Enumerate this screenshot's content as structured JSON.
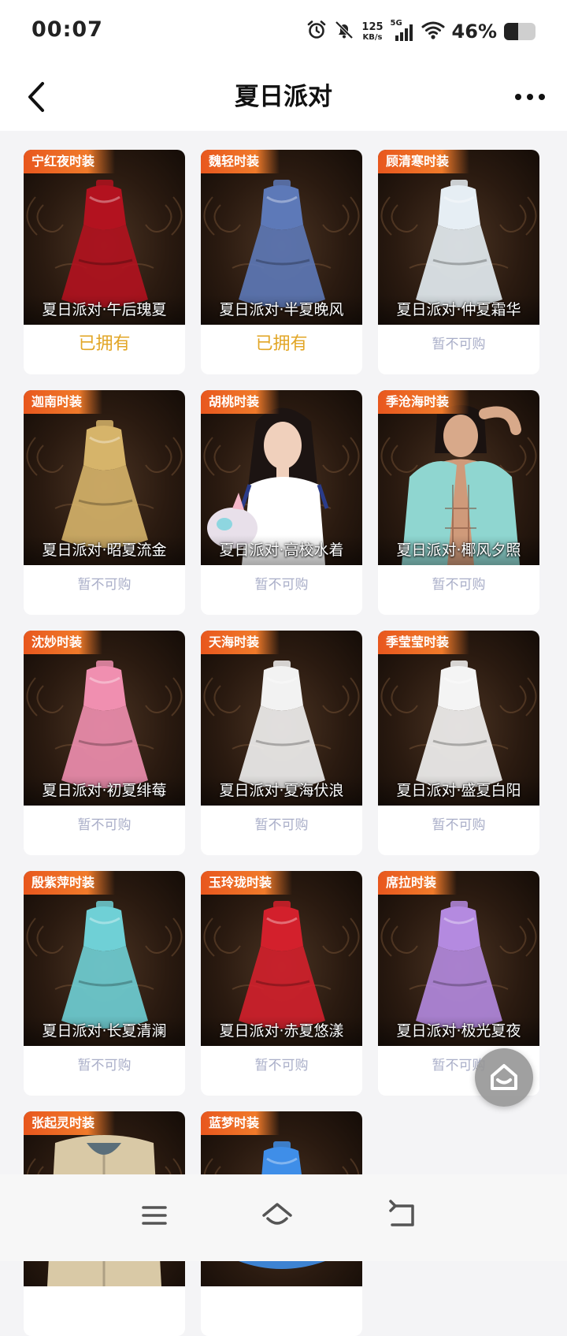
{
  "status_bar": {
    "time": "00:07",
    "net_speed_value": "125",
    "net_speed_unit": "KB/s",
    "network_type": "5G",
    "battery_percent": "46%",
    "battery_level": 0.46,
    "icons": [
      "alarm-icon",
      "mute-bell-icon",
      "signal-icon",
      "wifi-icon",
      "battery-icon"
    ]
  },
  "header": {
    "title": "夏日派对",
    "back_icon": "chevron-left-icon",
    "more_icon": "more-dots-icon"
  },
  "items": [
    {
      "tag": "宁红夜时装",
      "name": "夏日派对·午后瑰夏",
      "status": "已拥有",
      "owned": true,
      "art": "dress",
      "color": "#b3121f"
    },
    {
      "tag": "魏轻时装",
      "name": "夏日派对·半夏晚风",
      "status": "已拥有",
      "owned": true,
      "art": "dress",
      "color": "#5d79b8"
    },
    {
      "tag": "顾清寒时装",
      "name": "夏日派对·仲夏霜华",
      "status": "暂不可购",
      "owned": false,
      "art": "dress",
      "color": "#e6eef4"
    },
    {
      "tag": "迦南时装",
      "name": "夏日派对·昭夏流金",
      "status": "暂不可购",
      "owned": false,
      "art": "dress",
      "color": "#d6b46a"
    },
    {
      "tag": "胡桃时装",
      "name": "夏日派对·高校水着",
      "status": "暂不可购",
      "owned": false,
      "art": "girl",
      "color": "#ffffff"
    },
    {
      "tag": "季沧海时装",
      "name": "夏日派对·椰风夕照",
      "status": "暂不可购",
      "owned": false,
      "art": "man",
      "color": "#8fd6d0"
    },
    {
      "tag": "沈妙时装",
      "name": "夏日派对·初夏绯莓",
      "status": "暂不可购",
      "owned": false,
      "art": "dress",
      "color": "#f08fb0"
    },
    {
      "tag": "天海时装",
      "name": "夏日派对·夏海伏浪",
      "status": "暂不可购",
      "owned": false,
      "art": "dress",
      "color": "#f2f2f2"
    },
    {
      "tag": "季莹莹时装",
      "name": "夏日派对·盛夏白阳",
      "status": "暂不可购",
      "owned": false,
      "art": "dress",
      "color": "#f4f4f4"
    },
    {
      "tag": "殷紫萍时装",
      "name": "夏日派对·长夏清澜",
      "status": "暂不可购",
      "owned": false,
      "art": "dress",
      "color": "#6fd0d6"
    },
    {
      "tag": "玉玲珑时装",
      "name": "夏日派对·赤夏悠漾",
      "status": "暂不可购",
      "owned": false,
      "art": "dress",
      "color": "#d3202c"
    },
    {
      "tag": "席拉时装",
      "name": "夏日派对·极光夏夜",
      "status": "暂不可购",
      "owned": false,
      "art": "dress",
      "color": "#b48ae0"
    },
    {
      "tag": "张起灵时装",
      "name": "",
      "status": "",
      "owned": false,
      "art": "coat",
      "color": "#d9c9a6"
    },
    {
      "tag": "蓝梦时装",
      "name": "",
      "status": "",
      "owned": false,
      "art": "dress",
      "color": "#3f8ee8"
    }
  ],
  "floating_button": {
    "icon": "home-icon"
  },
  "bottom_nav": {
    "icons": [
      "menu-icon",
      "home-icon",
      "back-icon"
    ]
  }
}
